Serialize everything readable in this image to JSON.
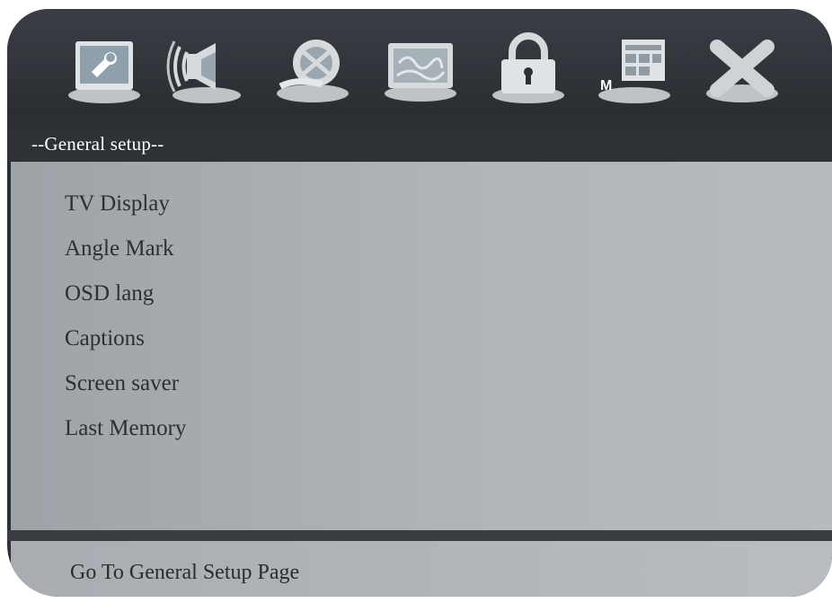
{
  "icon_bar": {
    "icons": [
      {
        "name": "general-setup",
        "semantic": "wrench-screen-icon"
      },
      {
        "name": "audio-setup",
        "semantic": "speaker-icon"
      },
      {
        "name": "video-setup",
        "semantic": "film-reel-icon"
      },
      {
        "name": "preference",
        "semantic": "picture-frame-icon"
      },
      {
        "name": "password",
        "semantic": "padlock-icon"
      },
      {
        "name": "misc",
        "semantic": "calendar-grid-icon"
      },
      {
        "name": "exit",
        "semantic": "close-x-icon"
      }
    ],
    "misc_icon_text": "M"
  },
  "section": {
    "title": "--General setup--"
  },
  "menu": {
    "items": [
      {
        "label": "TV Display"
      },
      {
        "label": "Angle Mark"
      },
      {
        "label": "OSD lang"
      },
      {
        "label": "Captions"
      },
      {
        "label": "Screen saver"
      },
      {
        "label": "Last Memory"
      }
    ]
  },
  "footer": {
    "help_text": "Go To General Setup Page"
  },
  "colors": {
    "frame": "#2c2f34",
    "panel": "#a8adb2",
    "text_dark": "#2d2f33",
    "title_text": "#ffffff",
    "icon_base": "#cfd3d6"
  }
}
